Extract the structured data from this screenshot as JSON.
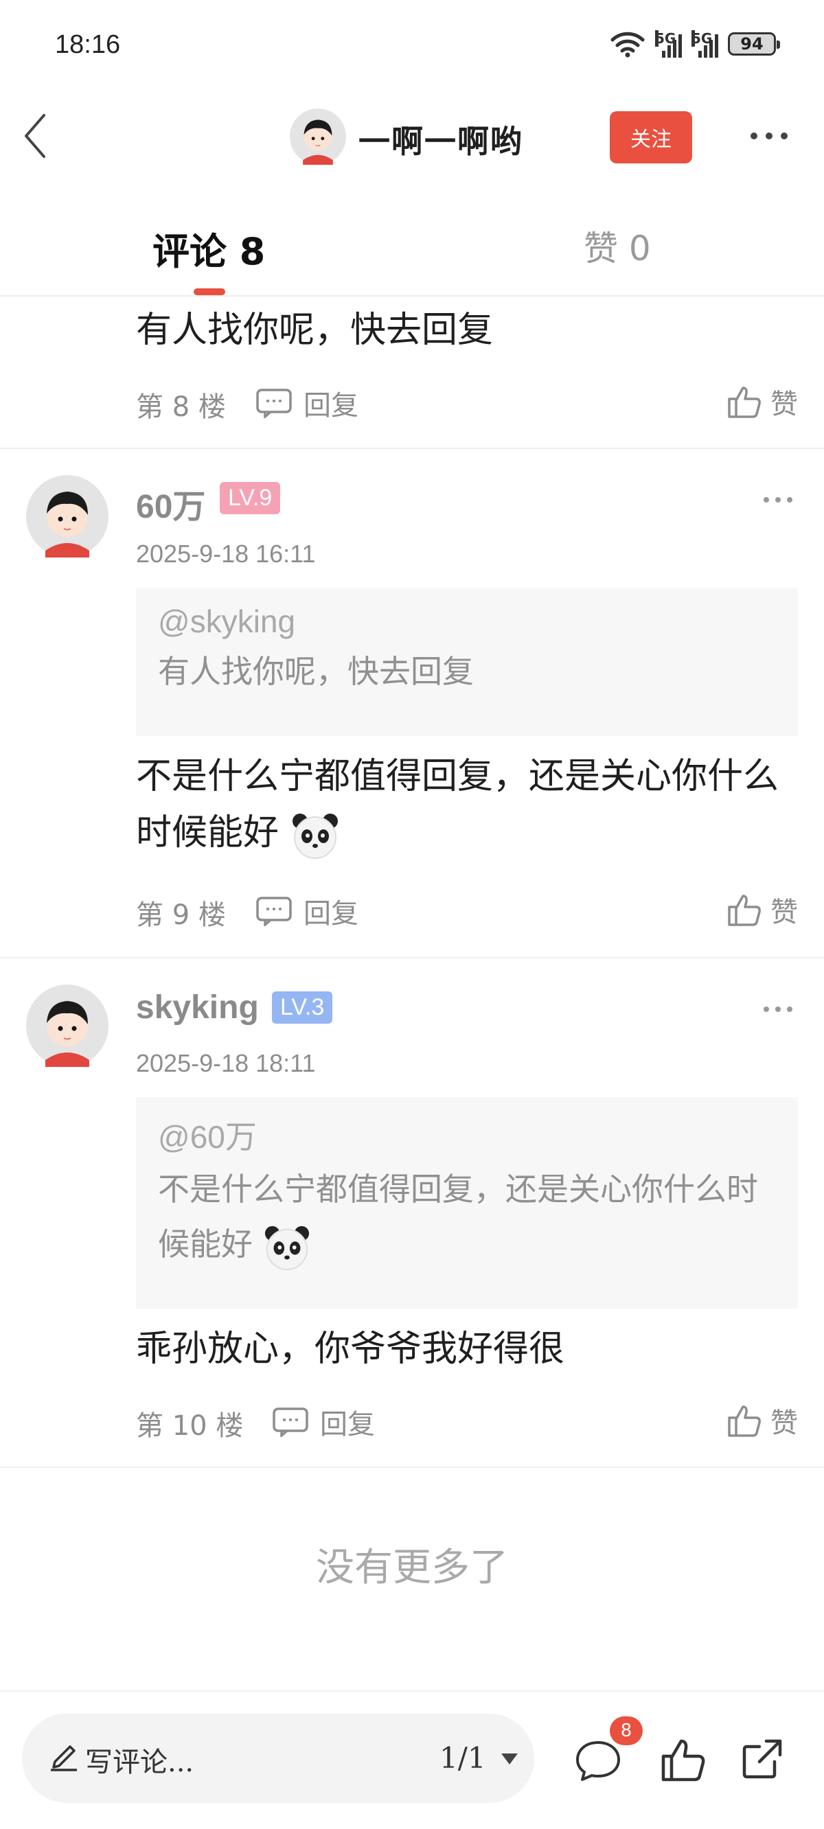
{
  "status_bar": {
    "time": "18:16",
    "signal1_label": "5G",
    "signal2_label": "5G",
    "battery": "94"
  },
  "header": {
    "username": "一啊一啊哟",
    "follow_label": "关注"
  },
  "tabs": [
    {
      "label": "评论 8",
      "active": true
    },
    {
      "label": "赞 0",
      "active": false
    }
  ],
  "comments": [
    {
      "text": "有人找你呢，快去回复",
      "floor": "第 8 楼",
      "reply_label": "回复",
      "like_label": "赞"
    },
    {
      "username": "60万",
      "level": "LV.9",
      "date": "2025-9-18 16:11",
      "quote_user": "@skyking",
      "quote_text": "有人找你呢，快去回复",
      "text": "不是什么宁都值得回复，还是关心你什么时候能好",
      "floor": "第 9 楼",
      "reply_label": "回复",
      "like_label": "赞"
    },
    {
      "username": "skyking",
      "level": "LV.3",
      "date": "2025-9-18 18:11",
      "quote_user": "@60万",
      "quote_text": "不是什么宁都值得回复，还是关心你什么时候能好",
      "text": "乖孙放心，你爷爷我好得很",
      "floor": "第 10 楼",
      "reply_label": "回复",
      "like_label": "赞"
    }
  ],
  "no_more": "没有更多了",
  "bottom_bar": {
    "write_placeholder": "写评论...",
    "page_indicator": "1/1",
    "comment_count": "8"
  },
  "colors": {
    "accent": "#e9503f",
    "level_pink": "#f5a2b5",
    "level_blue": "#94b6f2"
  }
}
